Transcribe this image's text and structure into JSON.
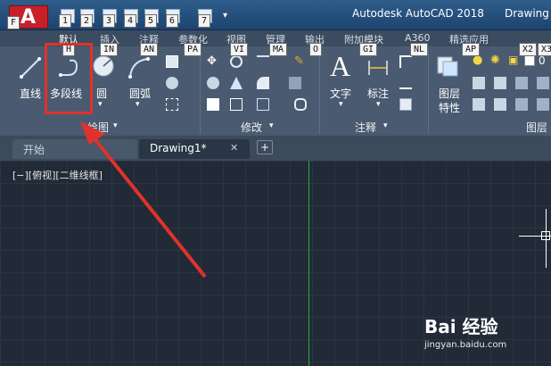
{
  "window": {
    "app_title": "Autodesk AutoCAD 2018",
    "doc_title": "Drawing"
  },
  "app_button": {
    "keytip": "F",
    "icon": "autocad-a-logo"
  },
  "quick_access": {
    "keytips": [
      "1",
      "2",
      "3",
      "4",
      "5",
      "6",
      "7"
    ]
  },
  "ribbon_tabs": [
    {
      "label": "默认",
      "keytip": "H"
    },
    {
      "label": "插入",
      "keytip": "IN"
    },
    {
      "label": "注释",
      "keytip": "AN"
    },
    {
      "label": "参数化",
      "keytip": "PA"
    },
    {
      "label": "视图",
      "keytip": "VI"
    },
    {
      "label": "管理",
      "keytip": "MA"
    },
    {
      "label": "输出",
      "keytip": "O"
    },
    {
      "label": "附加模块",
      "keytip": "GI"
    },
    {
      "label": "A360",
      "keytip": "NL"
    },
    {
      "label": "精选应用",
      "keytip": "AP"
    },
    {
      "label": "",
      "keytip": "X2"
    },
    {
      "label": "",
      "keytip": "X3"
    }
  ],
  "draw_panel": {
    "title": "绘图",
    "tools": {
      "line": "直线",
      "polyline": "多段线",
      "circle": "圆",
      "arc": "圆弧"
    }
  },
  "modify_panel": {
    "title": "修改"
  },
  "annotation_panel": {
    "title": "注释",
    "tools": {
      "text": "文字",
      "dimension": "标注"
    }
  },
  "layers_panel": {
    "title": "图层",
    "tools": {
      "layer_properties_line1": "图层",
      "layer_properties_line2": "特性"
    },
    "layer_value": "0"
  },
  "file_tabs": [
    {
      "label": "开始"
    },
    {
      "label": "Drawing1*"
    }
  ],
  "viewport": {
    "label": "[−][俯视][二维线框]"
  },
  "watermark": {
    "main": "Bai 经验",
    "sub": "jingyan.baidu.com"
  }
}
